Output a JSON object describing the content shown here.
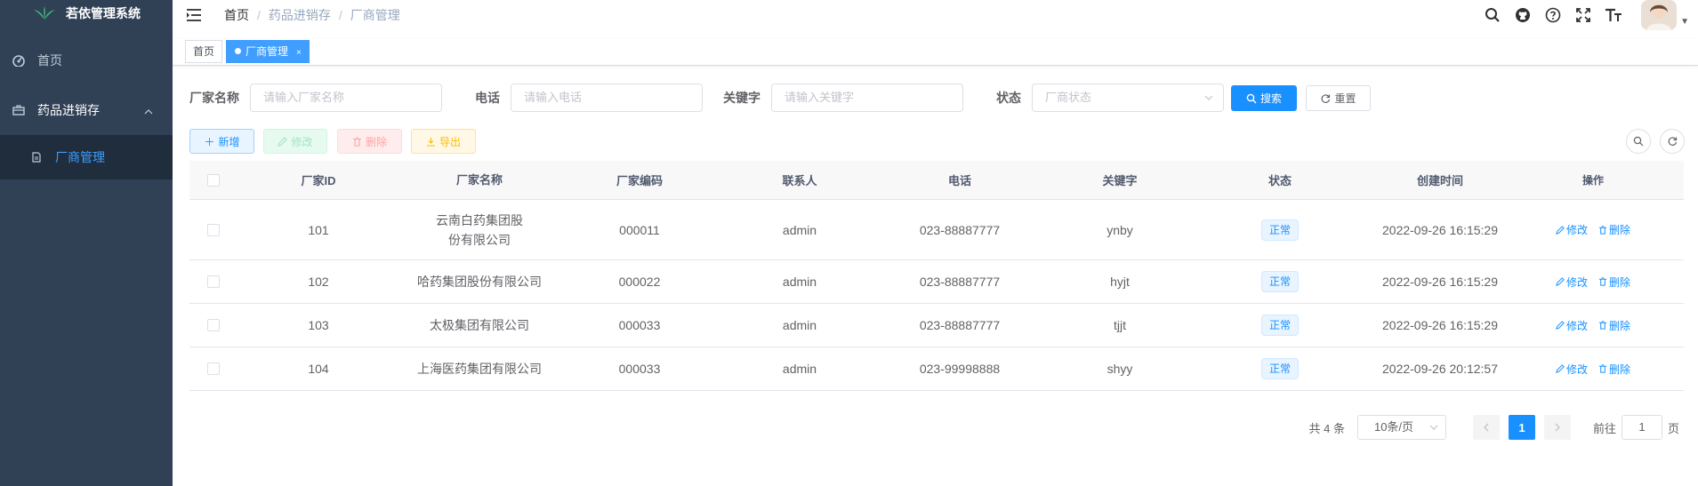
{
  "app": {
    "title": "若依管理系统"
  },
  "sidebar": {
    "items": [
      {
        "label": "首页",
        "icon": "dashboard-icon"
      },
      {
        "label": "药品进销存",
        "icon": "briefcase-icon"
      }
    ],
    "submenu": [
      {
        "label": "厂商管理",
        "icon": "document-icon"
      }
    ]
  },
  "breadcrumb": [
    "首页",
    "/",
    "药品进销存",
    "/",
    "厂商管理"
  ],
  "tags": [
    {
      "label": "首页"
    },
    {
      "label": "厂商管理",
      "close": "×"
    }
  ],
  "search": {
    "name_label": "厂家名称",
    "name_placeholder": "请输入厂家名称",
    "phone_label": "电话",
    "phone_placeholder": "请输入电话",
    "keyword_label": "关键字",
    "keyword_placeholder": "请输入关键字",
    "status_label": "状态",
    "status_placeholder": "厂商状态",
    "search_btn": "搜索",
    "reset_btn": "重置"
  },
  "toolbar": {
    "add": "新增",
    "edit": "修改",
    "delete": "删除",
    "export": "导出"
  },
  "table": {
    "headers": [
      "厂家ID",
      "厂家名称",
      "厂家编码",
      "联系人",
      "电话",
      "关键字",
      "状态",
      "创建时间",
      "操作"
    ],
    "rows": [
      {
        "id": "101",
        "name": "云南白药集团股份有限公司",
        "code": "000011",
        "contact": "admin",
        "phone": "023-88887777",
        "keyword": "ynby",
        "status": "正常",
        "time": "2022-09-26 16:15:29"
      },
      {
        "id": "102",
        "name": "哈药集团股份有限公司",
        "code": "000022",
        "contact": "admin",
        "phone": "023-88887777",
        "keyword": "hyjt",
        "status": "正常",
        "time": "2022-09-26 16:15:29"
      },
      {
        "id": "103",
        "name": "太极集团有限公司",
        "code": "000033",
        "contact": "admin",
        "phone": "023-88887777",
        "keyword": "tjjt",
        "status": "正常",
        "time": "2022-09-26 16:15:29"
      },
      {
        "id": "104",
        "name": "上海医药集团有限公司",
        "code": "000033",
        "contact": "admin",
        "phone": "023-99998888",
        "keyword": "shyy",
        "status": "正常",
        "time": "2022-09-26 20:12:57"
      }
    ],
    "op_edit": "修改",
    "op_delete": "删除"
  },
  "pagination": {
    "total": "共 4 条",
    "size": "10条/页",
    "current": "1",
    "goto_prefix": "前往",
    "goto_value": "1",
    "goto_suffix": "页"
  },
  "colors": {
    "sidebar": "#304156",
    "primary": "#1890ff",
    "submenu": "#1f2d3d"
  }
}
